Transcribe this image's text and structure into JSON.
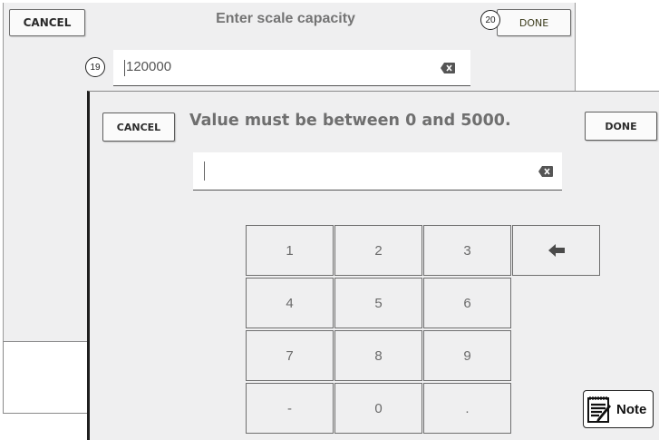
{
  "background_dialog": {
    "cancel_label": "CANCEL",
    "title": "Enter scale capacity",
    "done_label": "DONE",
    "input_value": "120000",
    "callout_input": "19",
    "callout_done": "20"
  },
  "validation_dialog": {
    "cancel_label": "CANCEL",
    "message": "Value must be between 0 and 5000.",
    "done_label": "DONE",
    "input_value": ""
  },
  "keypad": {
    "keys": [
      "1",
      "2",
      "3",
      "4",
      "5",
      "6",
      "7",
      "8",
      "9",
      "-",
      "0",
      "."
    ],
    "backspace_icon": "left-arrow-icon"
  },
  "note": {
    "label": "Note",
    "icon": "notepad-pencil-icon"
  },
  "colors": {
    "panel_bg": "#efeff0",
    "frame_dark": "#1e1e1e",
    "title_gray": "#747474"
  }
}
